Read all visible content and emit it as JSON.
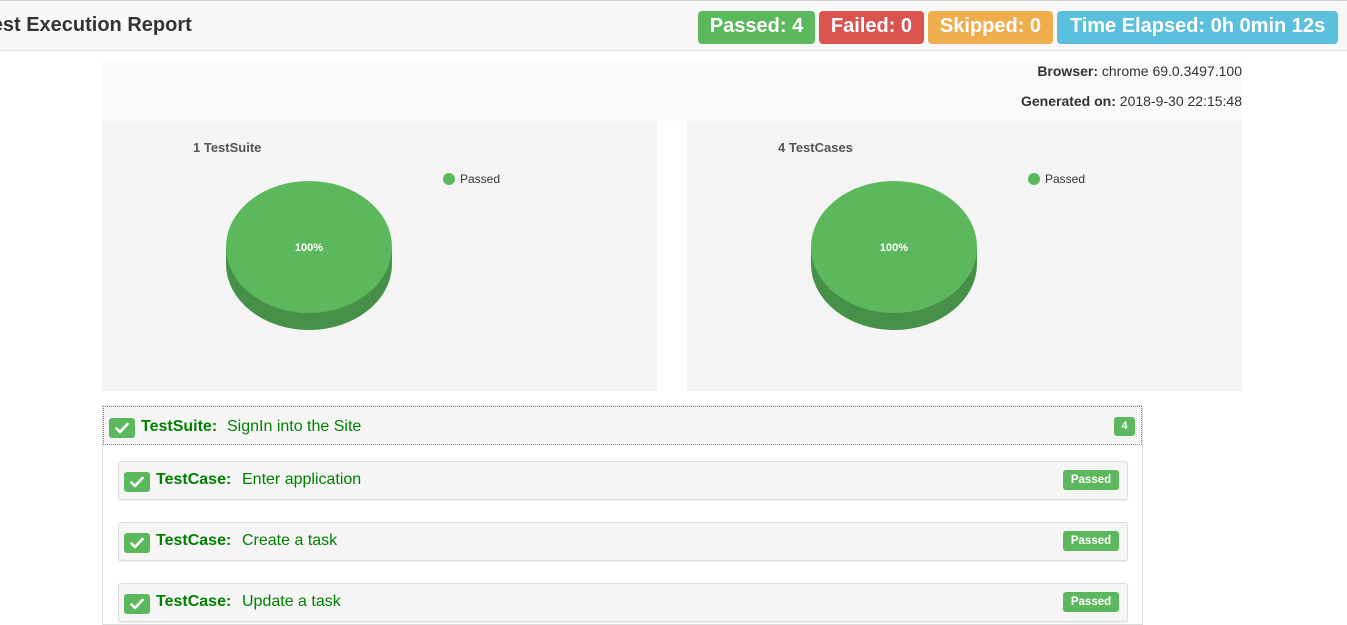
{
  "header": {
    "title": "Test Execution Report",
    "passed": "Passed: 4",
    "failed": "Failed: 0",
    "skipped": "Skipped: 0",
    "elapsed": "Time Elapsed: 0h 0min 12s"
  },
  "info": {
    "browser_label": "Browser:",
    "browser_value": "chrome 69.0.3497.100",
    "generated_label": "Generated on:",
    "generated_value": "2018-9-30 22:15:48"
  },
  "charts": [
    {
      "title": "1 TestSuite",
      "legend": "Passed",
      "slice_label": "100%",
      "passed_fraction": 1.0,
      "color": "#5cb85c"
    },
    {
      "title": "4 TestCases",
      "legend": "Passed",
      "slice_label": "100%",
      "passed_fraction": 1.0,
      "color": "#5cb85c"
    }
  ],
  "suite": {
    "prefix": "TestSuite:",
    "name": "SignIn into the Site",
    "count": "4",
    "cases": [
      {
        "prefix": "TestCase:",
        "name": "Enter application",
        "status": "Passed"
      },
      {
        "prefix": "TestCase:",
        "name": "Create a task",
        "status": "Passed"
      },
      {
        "prefix": "TestCase:",
        "name": "Update a task",
        "status": "Passed"
      }
    ]
  },
  "colors": {
    "passed": "#5cb85c",
    "failed": "#d9534f",
    "skipped": "#f0ad4e",
    "elapsed": "#5bc0de",
    "label_green": "#008000"
  }
}
